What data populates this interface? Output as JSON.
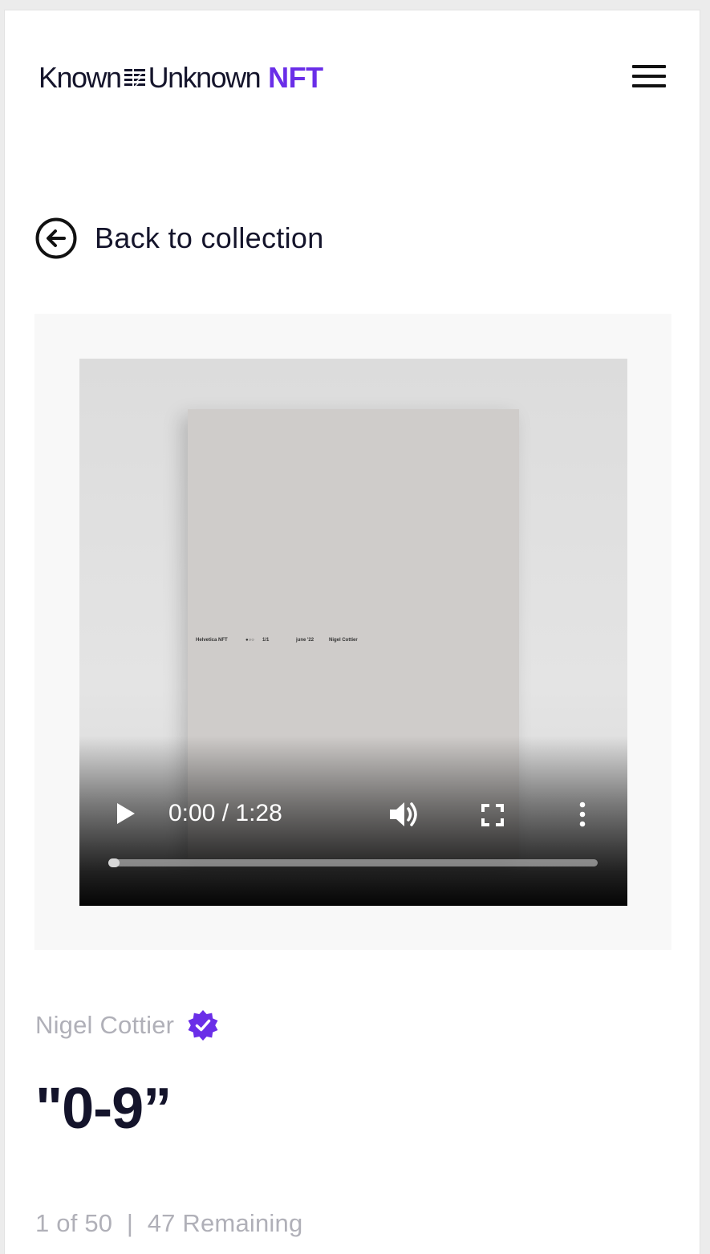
{
  "header": {
    "logo_known": "Known",
    "logo_unknown": "Unknown",
    "logo_nft": "NFT",
    "brand_color": "#6a2ee8",
    "menu_icon": "hamburger-menu-icon"
  },
  "nav": {
    "back_label": "Back to collection",
    "back_icon": "arrow-left-circle-icon"
  },
  "poster": {
    "texts": [
      "Helvetica NFT",
      "●○○",
      "1/1",
      "june '22",
      "Nigel Cottier"
    ]
  },
  "video": {
    "time": "0:00 / 1:28",
    "progress": 0.0,
    "icons": [
      "play-icon",
      "volume-icon",
      "fullscreen-icon",
      "more-vertical-icon"
    ]
  },
  "artwork": {
    "artist": "Nigel Cottier",
    "verified_icon": "verified-badge-icon",
    "title": "\"0-9”",
    "edition": "1 of 50  |  47 Remaining"
  }
}
